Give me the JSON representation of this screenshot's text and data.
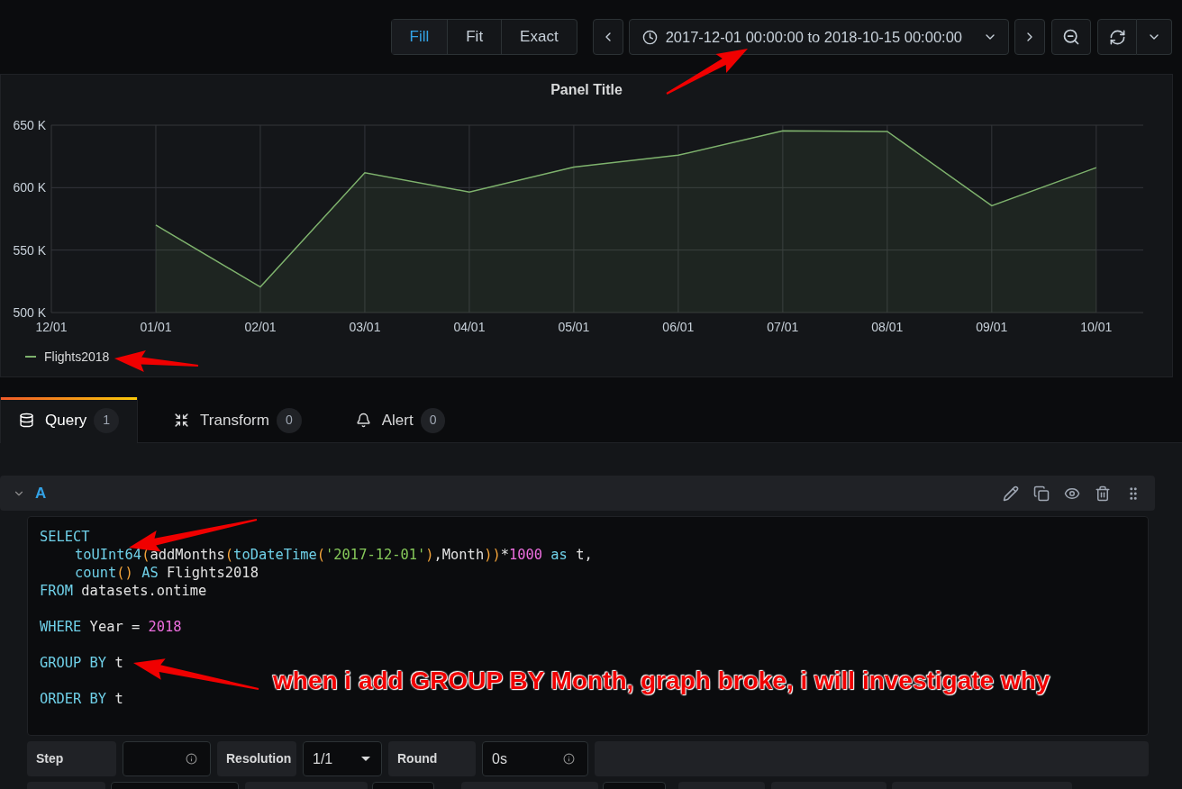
{
  "toolbar": {
    "view_modes": [
      {
        "label": "Fill",
        "selected": true
      },
      {
        "label": "Fit",
        "selected": false
      },
      {
        "label": "Exact",
        "selected": false
      }
    ],
    "time_range": "2017-12-01 00:00:00 to 2018-10-15 00:00:00"
  },
  "panel": {
    "title": "Panel Title",
    "chart_data": {
      "type": "area",
      "grid": true,
      "categories": [
        "12/01",
        "01/01",
        "02/01",
        "03/01",
        "04/01",
        "05/01",
        "06/01",
        "07/01",
        "08/01",
        "09/01",
        "10/01"
      ],
      "series": [
        {
          "name": "Flights2018",
          "color": "#7eb26d",
          "values": [
            null,
            570000,
            520500,
            612000,
            596500,
            616500,
            626000,
            645500,
            645000,
            585500,
            616000
          ]
        }
      ],
      "ylim": [
        500000,
        650000
      ],
      "yticks": [
        {
          "value": 500000,
          "label": "500 K"
        },
        {
          "value": 550000,
          "label": "550 K"
        },
        {
          "value": 600000,
          "label": "600 K"
        },
        {
          "value": 650000,
          "label": "650 K"
        }
      ]
    }
  },
  "tabs": [
    {
      "kind": "query",
      "label": "Query",
      "count": "1",
      "selected": true
    },
    {
      "kind": "transform",
      "label": "Transform",
      "count": "0",
      "selected": false
    },
    {
      "kind": "alert",
      "label": "Alert",
      "count": "0",
      "selected": false
    }
  ],
  "query": {
    "ref_id": "A",
    "expanded": true,
    "code": [
      {
        "kind": "code",
        "indented": false,
        "tokens": [
          {
            "kind": "keyword",
            "text": "SELECT"
          }
        ]
      },
      {
        "kind": "code",
        "indented": true,
        "tokens": [
          {
            "kind": "function",
            "text": "toUInt64"
          },
          {
            "kind": "paren",
            "text": "("
          },
          {
            "kind": "plain",
            "text": "addMonths"
          },
          {
            "kind": "paren",
            "text": "("
          },
          {
            "kind": "function",
            "text": "toDateTime"
          },
          {
            "kind": "paren",
            "text": "("
          },
          {
            "kind": "string",
            "text": "'2017-12-01'"
          },
          {
            "kind": "paren",
            "text": ")"
          },
          {
            "kind": "plain",
            "text": ",Month"
          },
          {
            "kind": "paren",
            "text": "))"
          },
          {
            "kind": "plain",
            "text": "*"
          },
          {
            "kind": "number",
            "text": "1000"
          },
          {
            "kind": "keyword",
            "text": " as"
          },
          {
            "kind": "plain",
            "text": " t,"
          }
        ]
      },
      {
        "kind": "code",
        "indented": true,
        "tokens": [
          {
            "kind": "function",
            "text": "count"
          },
          {
            "kind": "paren",
            "text": "()"
          },
          {
            "kind": "keyword",
            "text": " AS"
          },
          {
            "kind": "plain",
            "text": " Flights2018"
          }
        ]
      },
      {
        "kind": "code",
        "indented": false,
        "tokens": [
          {
            "kind": "keyword",
            "text": "FROM"
          },
          {
            "kind": "plain",
            "text": " datasets.ontime"
          }
        ]
      },
      {
        "kind": "blank"
      },
      {
        "kind": "code",
        "indented": false,
        "tokens": [
          {
            "kind": "keyword",
            "text": "WHERE"
          },
          {
            "kind": "plain",
            "text": " Year = "
          },
          {
            "kind": "number",
            "text": "2018"
          }
        ]
      },
      {
        "kind": "blank"
      },
      {
        "kind": "code",
        "indented": false,
        "tokens": [
          {
            "kind": "keyword",
            "text": "GROUP BY"
          },
          {
            "kind": "plain",
            "text": " t"
          }
        ]
      },
      {
        "kind": "blank"
      },
      {
        "kind": "code",
        "indented": false,
        "tokens": [
          {
            "kind": "keyword",
            "text": "ORDER BY"
          },
          {
            "kind": "plain",
            "text": " t"
          }
        ]
      }
    ],
    "options": [
      {
        "kind": "label",
        "text": "Step"
      },
      {
        "kind": "input",
        "info": true
      },
      {
        "kind": "label",
        "text": "Resolution"
      },
      {
        "kind": "select",
        "value": "1/1"
      },
      {
        "kind": "label",
        "text": "Round"
      },
      {
        "kind": "input",
        "value": "0s",
        "info": true
      },
      {
        "kind": "filler"
      }
    ],
    "more_options": [
      {
        "kind": "label"
      },
      {
        "kind": "input"
      },
      {
        "kind": "label"
      },
      {
        "kind": "input"
      },
      {
        "kind": "label"
      },
      {
        "kind": "input"
      },
      {
        "kind": "label"
      },
      {
        "kind": "label"
      },
      {
        "kind": "label"
      }
    ]
  },
  "annotation": {
    "note": "when i add GROUP BY Month, graph broke, i will investigate why"
  }
}
